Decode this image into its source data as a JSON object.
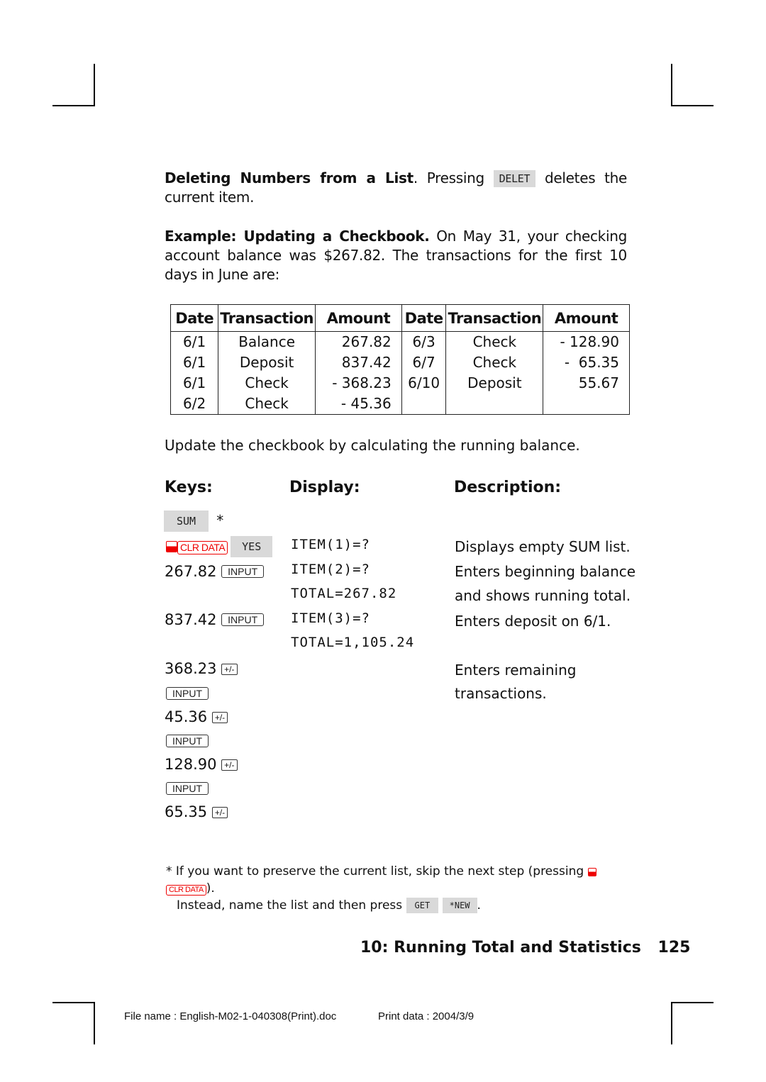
{
  "intro": {
    "delete_heading": "Deleting Numbers from a List",
    "delete_pre": ". Pressing ",
    "delete_key": "DELET",
    "delete_post": " deletes the current item.",
    "example_heading": "Example: Updating a Checkbook.",
    "example_text": " On May 31, your checking account balance was $267.82. The transactions for the first 10 days in June are:"
  },
  "table": {
    "headers": [
      "Date",
      "Transaction",
      "Amount",
      "Date",
      "Transaction",
      "Amount"
    ],
    "rows": [
      [
        "6/1",
        "Balance",
        "267.82",
        "6/3",
        "Check",
        "- 128.90"
      ],
      [
        "6/1",
        "Deposit",
        "837.42",
        "6/7",
        "Check",
        "-  65.35"
      ],
      [
        "6/1",
        "Check",
        "- 368.23",
        "6/10",
        "Deposit",
        "55.67"
      ],
      [
        "6/2",
        "Check",
        "- 45.36",
        "",
        "",
        ""
      ]
    ]
  },
  "instruction": "Update the checkbook by calculating the running balance.",
  "columns": {
    "keys": "Keys:",
    "display": "Display:",
    "description": "Description:"
  },
  "steps": {
    "sum_key": "SUM",
    "asterisk": "*",
    "clr_data": "CLR DATA",
    "yes_key": "YES",
    "display1": "ITEM(1)=?",
    "desc1": "Displays empty SUM list.",
    "value2": "267.82",
    "input_key": "INPUT",
    "display2": "ITEM(2)=?",
    "display2b": "TOTAL=267.82",
    "desc2": "Enters beginning balance",
    "desc2b": "and shows running total.",
    "value3": "837.42",
    "display3": "ITEM(3)=?",
    "display3b": "TOTAL=1,105.24",
    "desc3": "Enters deposit on 6/1.",
    "value4": "368.23",
    "pm_key": "+/-",
    "desc4": "Enters remaining",
    "desc4b": "transactions.",
    "value5": "45.36",
    "value6": "128.90",
    "value7": "65.35"
  },
  "footnote": {
    "star": "*",
    "line1": " If you want to preserve the current list, skip the next step (pressing ",
    "line1_end": ").",
    "line2": "Instead, name the list and then press ",
    "get_key": "GET",
    "new_key": "*NEW",
    "line2_end": "."
  },
  "page_footer": {
    "chapter": "10: Running Total and Statistics",
    "page_number": "125"
  },
  "print_info": {
    "file_name": "File name : English-M02-1-040308(Print).doc",
    "print_date": "Print data : 2004/3/9"
  }
}
